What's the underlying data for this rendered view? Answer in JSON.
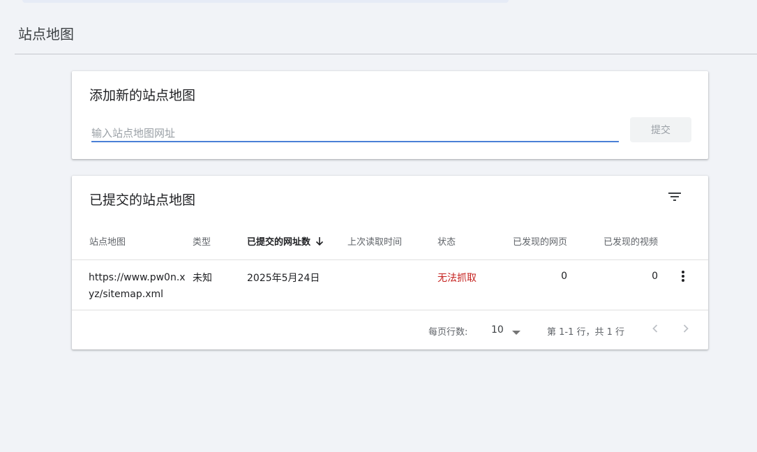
{
  "page": {
    "title": "站点地图"
  },
  "add_card": {
    "title": "添加新的站点地图",
    "input_placeholder": "输入站点地图网址",
    "input_value": "",
    "submit_label": "提交"
  },
  "list_card": {
    "title": "已提交的站点地图",
    "filter_icon": "filter-icon",
    "columns": [
      "站点地图",
      "类型",
      "已提交的网址数",
      "上次读取时间",
      "状态",
      "已发现的网页",
      "已发现的视频"
    ],
    "sorted_column": "已提交的网址数",
    "rows": [
      {
        "sitemap_line1": "https://www.pw0n.x",
        "sitemap_line2": "yz/sitemap.xml",
        "type": "未知",
        "submitted": "2025年5月24日",
        "last_read": "",
        "status": "无法抓取",
        "pages": "0",
        "videos": "0"
      }
    ],
    "footer": {
      "rows_per_page_label": "每页行数:",
      "rows_per_page_value": "10",
      "range_text": "第 1-1 行，共 1 行"
    }
  },
  "colors": {
    "background": "#f1f3f7",
    "input_underline": "#4a7fd6",
    "status_error": "#c5221f"
  }
}
